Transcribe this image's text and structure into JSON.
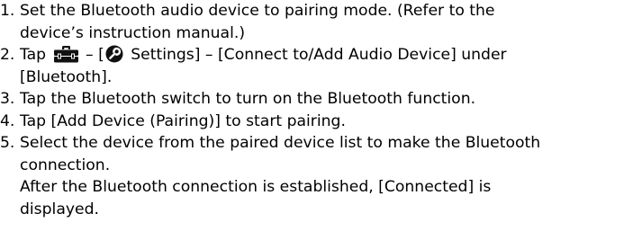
{
  "steps": [
    {
      "num": "1.",
      "lines": [
        "Set the Bluetooth audio device to pairing mode. (Refer to the",
        "device’s instruction manual.)"
      ]
    },
    {
      "num": "2.",
      "parts": {
        "pre": "Tap ",
        "mid1": " – [",
        "settings": " Settings] – [Connect to/Add Audio Device] under"
      },
      "line2": "[Bluetooth].",
      "icons": [
        "toolbox-icon",
        "settings-icon"
      ]
    },
    {
      "num": "3.",
      "lines": [
        "Tap the Bluetooth switch to turn on the Bluetooth function."
      ]
    },
    {
      "num": "4.",
      "lines": [
        "Tap [Add Device (Pairing)] to start pairing."
      ]
    },
    {
      "num": "5.",
      "lines": [
        "Select the device from the paired device list to make the Bluetooth",
        "connection.",
        "After the Bluetooth connection is established, [Connected] is",
        "displayed."
      ]
    }
  ],
  "colors": {
    "text": "#000000",
    "icon": "#111111",
    "background": "#ffffff"
  }
}
